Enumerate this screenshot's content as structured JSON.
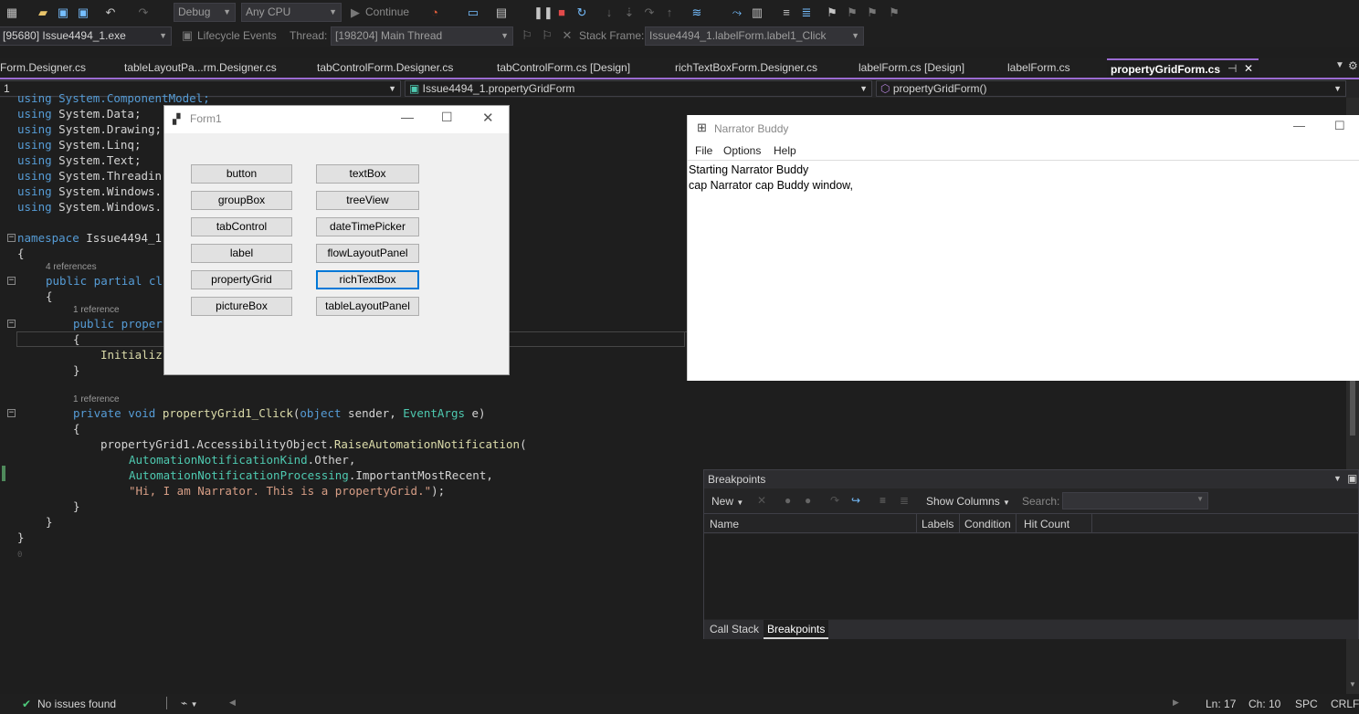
{
  "toolbar": {
    "config": "Debug",
    "platform": "Any CPU",
    "continue_label": "Continue",
    "process": "[95680] Issue4494_1.exe",
    "lifecycle_label": "Lifecycle Events",
    "thread_label": "Thread:",
    "thread_value": "[198204] Main Thread",
    "stackframe_label": "Stack Frame:",
    "stackframe_value": "Issue4494_1.labelForm.label1_Click"
  },
  "tabs": [
    {
      "label": "Form.Designer.cs"
    },
    {
      "label": "tableLayoutPa...rm.Designer.cs"
    },
    {
      "label": "tabControlForm.Designer.cs"
    },
    {
      "label": "tabControlForm.cs [Design]"
    },
    {
      "label": "richTextBoxForm.Designer.cs"
    },
    {
      "label": "labelForm.cs [Design]"
    },
    {
      "label": "labelForm.cs"
    },
    {
      "label": "propertyGridForm.cs"
    }
  ],
  "navbar": {
    "project": "1",
    "type": "Issue4494_1.propertyGridForm",
    "member": "propertyGridForm()"
  },
  "code": {
    "l0": "using System.ComponentModel;",
    "l1a": "using",
    "l1b": " System.Data;",
    "l2a": "using",
    "l2b": " System.Drawing;",
    "l3a": "using",
    "l3b": " System.Linq;",
    "l4a": "using",
    "l4b": " System.Text;",
    "l5a": "using",
    "l5b": " System.Threadin",
    "l6a": "using",
    "l6b": " System.Windows.",
    "l7a": "using",
    "l7b": " System.Windows.",
    "ns_kw": "namespace",
    "ns_name": " Issue4494_1",
    "brace_open": "{",
    "ref4": "4 references",
    "class_kw": "public partial cl",
    "brace_open2": "{",
    "ref1a": "1 reference",
    "ctor": "public proper",
    "brace_open3": "{",
    "init": "Initializ",
    "brace_close3": "}",
    "ref1b": "1 reference",
    "m_private": "private",
    "m_void": " void",
    "m_name": " propertyGrid1_Click",
    "m_p1": "(",
    "m_object": "object",
    "m_sender": " sender, ",
    "m_eventargs": "EventArgs",
    "m_e": " e)",
    "brace_open4": "{",
    "c1": "propertyGrid1.AccessibilityObject.",
    "c1m": "RaiseAutomationNotification",
    "c1p": "(",
    "c2t": "AutomationNotificationKind",
    "c2r": ".Other,",
    "c3t": "AutomationNotificationProcessing",
    "c3r": ".ImportantMostRecent,",
    "c4s": "\"Hi, I am Narrator. This is a propertyGrid.\"",
    "c4r": ");",
    "brace_close4": "}",
    "brace_close2": "}",
    "brace_close1": "}",
    "zero": "0"
  },
  "form1": {
    "title": "Form1",
    "buttons": [
      "button",
      "textBox",
      "groupBox",
      "treeView",
      "tabControl",
      "dateTimePicker",
      "label",
      "flowLayoutPanel",
      "propertyGrid",
      "richTextBox",
      "pictureBox",
      "tableLayoutPanel"
    ]
  },
  "narrator": {
    "title": "Narrator Buddy",
    "menu": [
      "File",
      "Options",
      "Help"
    ],
    "line1": "Starting Narrator Buddy",
    "line2": "cap Narrator cap Buddy window,"
  },
  "breakpoints": {
    "title": "Breakpoints",
    "new_label": "New",
    "show_columns": "Show Columns",
    "search_label": "Search:",
    "columns": [
      "Name",
      "Labels",
      "Condition",
      "Hit Count"
    ],
    "bottom_tabs": [
      "Call Stack",
      "Breakpoints"
    ]
  },
  "status": {
    "issues": "No issues found",
    "ln": "Ln: 17",
    "ch": "Ch: 10",
    "spc": "SPC",
    "crlf": "CRLF"
  },
  "colors": {
    "accent": "#9b6bd2",
    "keyword": "#569cd6",
    "type": "#4ec9b0",
    "string": "#d69d85",
    "method": "#dcdcaa"
  }
}
